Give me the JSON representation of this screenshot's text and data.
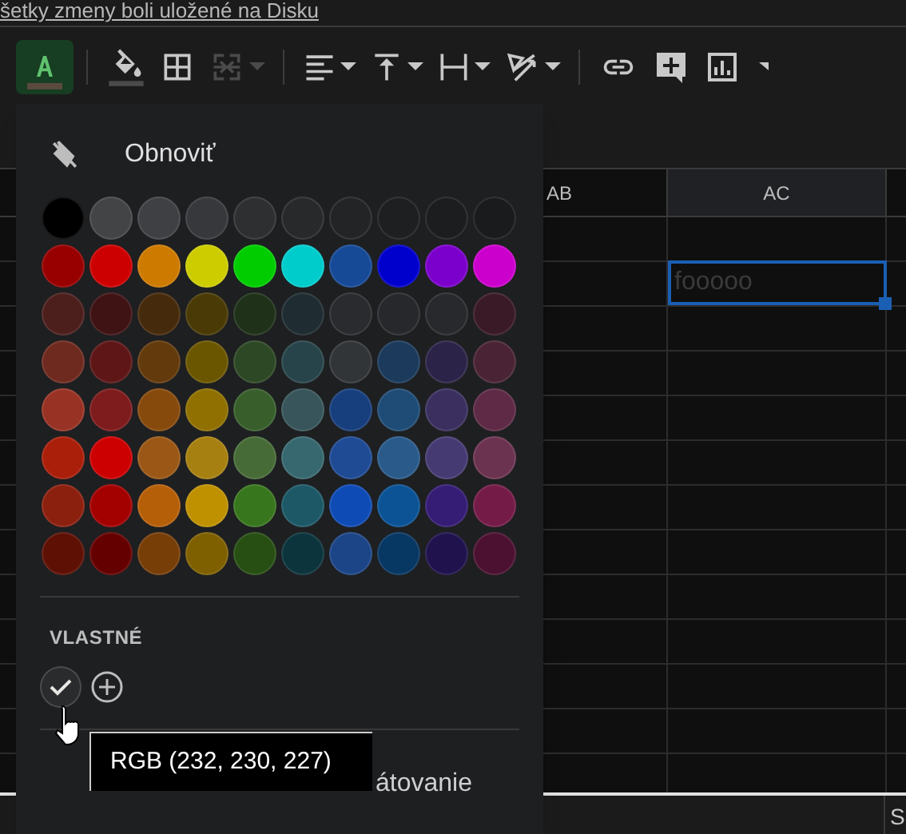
{
  "save_status": "šetky zmeny boli uložené na Disku",
  "toolbar": [
    {
      "kind": "text-color",
      "selected": true,
      "disabled": false,
      "dropdown": false
    },
    {
      "kind": "separator"
    },
    {
      "kind": "fill-color",
      "selected": false,
      "disabled": false,
      "dropdown": false
    },
    {
      "kind": "borders",
      "selected": false,
      "disabled": false,
      "dropdown": false
    },
    {
      "kind": "merge",
      "selected": false,
      "disabled": true,
      "dropdown": true
    },
    {
      "kind": "separator"
    },
    {
      "kind": "align",
      "selected": false,
      "disabled": false,
      "dropdown": true
    },
    {
      "kind": "valign",
      "selected": false,
      "disabled": false,
      "dropdown": true
    },
    {
      "kind": "wrap",
      "selected": false,
      "disabled": false,
      "dropdown": true
    },
    {
      "kind": "rotate",
      "selected": false,
      "disabled": false,
      "dropdown": true
    },
    {
      "kind": "separator"
    },
    {
      "kind": "link",
      "selected": false,
      "disabled": false,
      "dropdown": false
    },
    {
      "kind": "comment",
      "selected": false,
      "disabled": false,
      "dropdown": false
    },
    {
      "kind": "chart",
      "selected": false,
      "disabled": false,
      "dropdown": false
    }
  ],
  "grid": {
    "columns": [
      {
        "label": "AB",
        "selected": false
      },
      {
        "label": "AC",
        "selected": true
      }
    ],
    "selected_cell": "fooooo",
    "bottom_tab": "S"
  },
  "color_menu": {
    "reset": "Obnoviť",
    "palette": [
      {
        "colors": [
          {
            "color": "#000000"
          },
          {
            "color": "#434446"
          },
          {
            "color": "#3e4043"
          },
          {
            "color": "#36383b"
          },
          {
            "color": "#2d2f31"
          },
          {
            "color": "#28292b"
          },
          {
            "color": "#232425"
          },
          {
            "color": "#1e1f20"
          },
          {
            "color": "#1c1d1e"
          },
          {
            "color": "#1a1b1c"
          }
        ]
      },
      {
        "colors": [
          {
            "color": "#980000"
          },
          {
            "color": "#cc0000"
          },
          {
            "color": "#cc7a00"
          },
          {
            "color": "#cccc00"
          },
          {
            "color": "#00cc00"
          },
          {
            "color": "#00cccc"
          },
          {
            "color": "#174a96"
          },
          {
            "color": "#0000cc"
          },
          {
            "color": "#7b00cc"
          },
          {
            "color": "#cc00cc"
          }
        ]
      },
      {
        "colors": [
          {
            "color": "#4c1f1c"
          },
          {
            "color": "#3f1214"
          },
          {
            "color": "#462a0c"
          },
          {
            "color": "#4a3a05"
          },
          {
            "color": "#1f3219"
          },
          {
            "color": "#1f2c31"
          },
          {
            "color": "#2a2b2e"
          },
          {
            "color": "#27282b"
          },
          {
            "color": "#28292c"
          },
          {
            "color": "#3a1a27"
          }
        ]
      },
      {
        "colors": [
          {
            "color": "#6f2a20"
          },
          {
            "color": "#5e1617"
          },
          {
            "color": "#633a0c"
          },
          {
            "color": "#6b5600"
          },
          {
            "color": "#2d4825"
          },
          {
            "color": "#27444a"
          },
          {
            "color": "#323538"
          },
          {
            "color": "#1b3a5c"
          },
          {
            "color": "#2c2448"
          },
          {
            "color": "#4a2435"
          }
        ]
      },
      {
        "colors": [
          {
            "color": "#983224"
          },
          {
            "color": "#7d1b1d"
          },
          {
            "color": "#874a0d"
          },
          {
            "color": "#8f7000"
          },
          {
            "color": "#385e2c"
          },
          {
            "color": "#37555a"
          },
          {
            "color": "#183f7d"
          },
          {
            "color": "#1f4c76"
          },
          {
            "color": "#3a2f5f"
          },
          {
            "color": "#5e2a46"
          }
        ]
      },
      {
        "colors": [
          {
            "color": "#a91f0a"
          },
          {
            "color": "#cc0001"
          },
          {
            "color": "#9a5716"
          },
          {
            "color": "#a68010"
          },
          {
            "color": "#466b37"
          },
          {
            "color": "#376870"
          },
          {
            "color": "#1f4b94"
          },
          {
            "color": "#295a8a"
          },
          {
            "color": "#453a72"
          },
          {
            "color": "#6c3351"
          }
        ]
      },
      {
        "colors": [
          {
            "color": "#8c200f"
          },
          {
            "color": "#a30000"
          },
          {
            "color": "#b55f09"
          },
          {
            "color": "#bf9000"
          },
          {
            "color": "#38761d"
          },
          {
            "color": "#1c5866"
          },
          {
            "color": "#0f4bb5"
          },
          {
            "color": "#0b5394"
          },
          {
            "color": "#351c75"
          },
          {
            "color": "#741b47"
          }
        ]
      },
      {
        "colors": [
          {
            "color": "#5e1005"
          },
          {
            "color": "#650000"
          },
          {
            "color": "#773e08"
          },
          {
            "color": "#7f6000"
          },
          {
            "color": "#274e13"
          },
          {
            "color": "#0c343d"
          },
          {
            "color": "#1c4587"
          },
          {
            "color": "#073763"
          },
          {
            "color": "#20124d"
          },
          {
            "color": "#4c1130"
          }
        ]
      }
    ],
    "custom_heading": "VLASTNÉ",
    "custom_colors": [
      {
        "selected": true
      }
    ],
    "item_partial": "átovanie"
  },
  "tooltip": "RGB (232, 230, 227)"
}
